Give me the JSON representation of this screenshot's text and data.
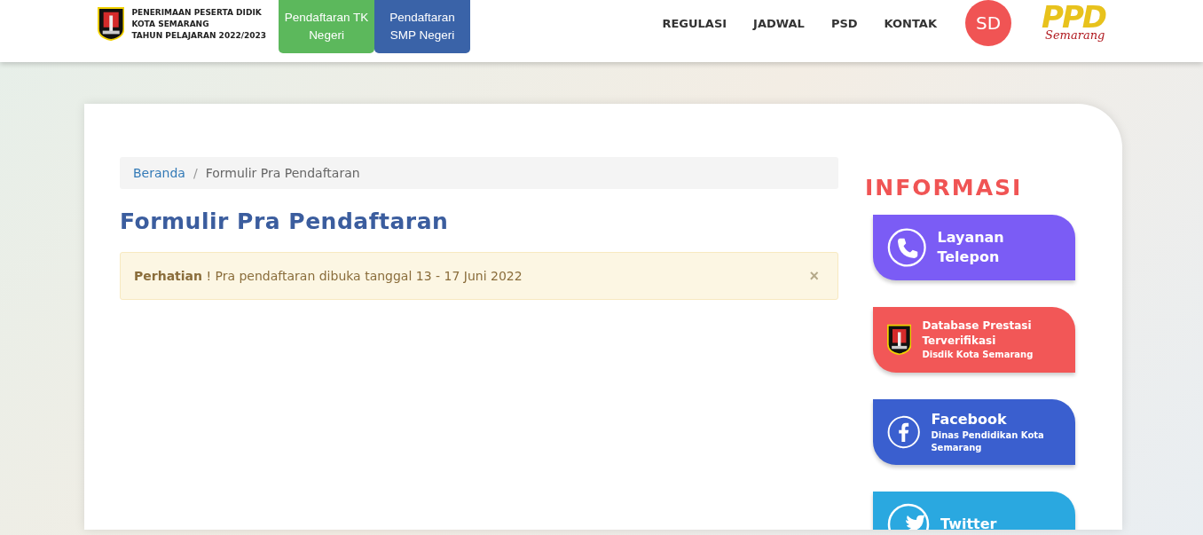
{
  "header": {
    "brand_lines": [
      "PENERIMAAN PESERTA DIDIK",
      "KOTA SEMARANG",
      "TAHUN PELAJARAN 2022/2023"
    ],
    "register_buttons": [
      {
        "label": "Pendaftaran TK Negeri",
        "color": "#5cb85c"
      },
      {
        "label": "Pendaftaran SMP Negeri",
        "color": "#3a63a8"
      }
    ],
    "nav": [
      "REGULASI",
      "JADWAL",
      "PSD",
      "KONTAK"
    ],
    "level_badge": "SD",
    "logo": {
      "main": "PPD",
      "sub": "Semarang"
    }
  },
  "breadcrumb": [
    {
      "label": "Beranda",
      "link": true
    },
    {
      "label": "Formulir Pra Pendaftaran",
      "link": false
    }
  ],
  "breadcrumb_separator": "/",
  "page_title": "Formulir Pra Pendaftaran",
  "alert": {
    "text": "**Perhatian** ! Pra pendaftaran dibuka tanggal 13 - 17 Juni 2022",
    "close": "×"
  },
  "sidebar": {
    "title": "INFORMASI",
    "cards": [
      {
        "kind": "phone",
        "color": "#7b5cf5",
        "title": "Layanan Telepon"
      },
      {
        "kind": "emblem",
        "color": "#f25757",
        "title": "Database Prestasi Terverifikasi",
        "subtitle": "Disdik Kota Semarang"
      },
      {
        "kind": "facebook",
        "color": "#3a5fcf",
        "title": "Facebook",
        "subtitle": "Dinas Pendidikan Kota Semarang"
      },
      {
        "kind": "twitter",
        "color": "#2aa8e0",
        "title": "Twitter"
      }
    ]
  }
}
